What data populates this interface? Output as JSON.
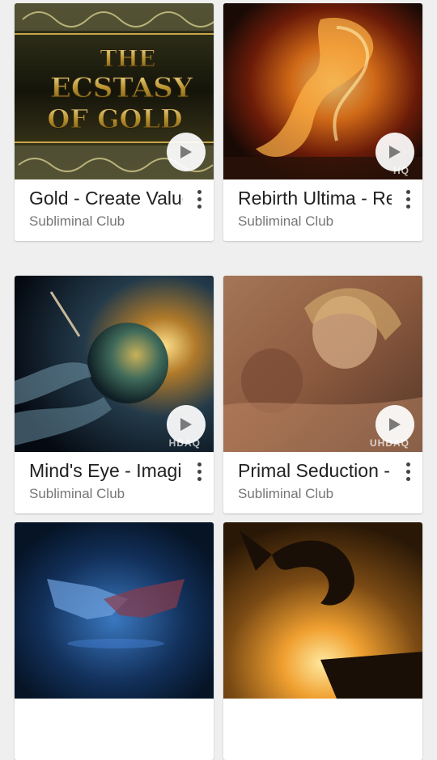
{
  "cards": [
    {
      "title": "Gold - Create Value",
      "channel": "Subliminal Club",
      "thumb_text": [
        "THE",
        "ECSTASY",
        "OF GOLD"
      ]
    },
    {
      "title": "Rebirth Ultima - Rebirth",
      "channel": "Subliminal Club",
      "badge": "HQ"
    },
    {
      "title": "Mind's Eye - Imagination",
      "channel": "Subliminal Club",
      "badge": "HDAQ"
    },
    {
      "title": "Primal Seduction - ",
      "channel": "Subliminal Club",
      "badge": "UHDAQ"
    },
    {
      "title": "",
      "channel": ""
    },
    {
      "title": "",
      "channel": ""
    }
  ],
  "colors": {
    "background": "#efefef",
    "card": "#ffffff",
    "title": "#212121",
    "subtitle": "#767676"
  },
  "icons": {
    "play": "play-icon",
    "more": "more-vert-icon"
  }
}
